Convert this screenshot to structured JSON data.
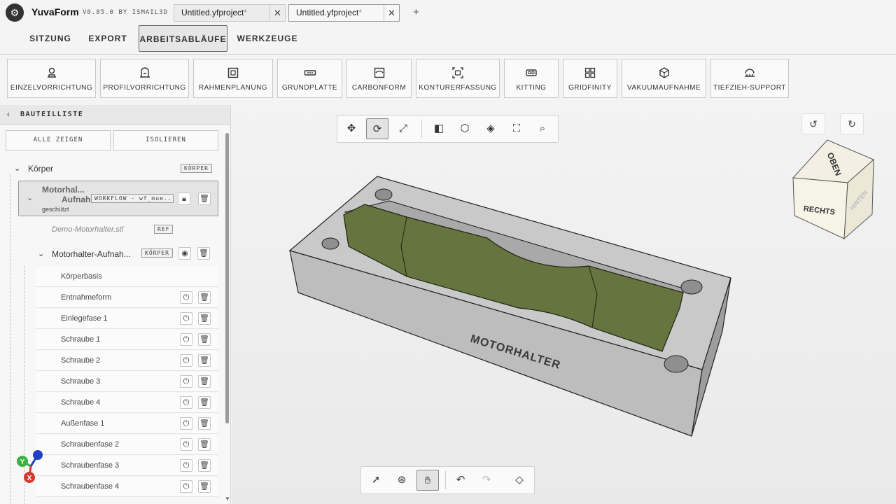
{
  "app": {
    "name": "YuvaForm",
    "version": "V0.85.0 BY ISMAIL3D"
  },
  "file_tabs": [
    {
      "label": "Untitled.yfproject",
      "modified_mark": "*"
    },
    {
      "label": "Untitled.yfproject",
      "modified_mark": "*"
    }
  ],
  "new_tab_label": "+",
  "menu": [
    "SITZUNG",
    "EXPORT",
    "ARBEITSABLÄUFE",
    "WERKZEUGE"
  ],
  "menu_active": "ARBEITSABLÄUFE",
  "workflows": [
    {
      "label": "EINZELVORRICHTUNG",
      "icon": "fixture-icon"
    },
    {
      "label": "PROFILVORRICHTUNG",
      "icon": "profile-fixture-icon"
    },
    {
      "label": "RAHMENPLANUNG",
      "icon": "frame-icon"
    },
    {
      "label": "GRUNDPLATTE",
      "icon": "baseplate-icon"
    },
    {
      "label": "CARBONFORM",
      "icon": "carbon-form-icon"
    },
    {
      "label": "KONTURERFASSUNG",
      "icon": "contour-icon"
    },
    {
      "label": "KITTING",
      "icon": "kitting-icon"
    },
    {
      "label": "GRIDFINITY",
      "icon": "grid-icon"
    },
    {
      "label": "VAKUUMAUFNAHME",
      "icon": "vacuum-icon"
    },
    {
      "label": "TIEFZIEH-SUPPORT",
      "icon": "thermoform-icon"
    }
  ],
  "panel": {
    "title": "BAUTEILLISTE",
    "show_all": "ALLE ZEIGEN",
    "isolate": "ISOLIEREN",
    "root": {
      "label": "Körper",
      "badge": "KÖRPER"
    },
    "group": {
      "label_line1": "Motorhal...",
      "label_line2": "Aufnahme",
      "sub": "geschützt",
      "badge": "WORKFLOW · wf_mue..."
    },
    "ref_file": {
      "label": "Demo-Motorhalter.stl",
      "badge": "REF"
    },
    "body": {
      "label": "Motorhalter-Aufnah...",
      "badge": "KÖRPER"
    },
    "base_feature": "Körperbasis",
    "features": [
      "Entnahmeform",
      "Einlegefase 1",
      "Schraube 1",
      "Schraube 2",
      "Schraube 3",
      "Schraube 4",
      "Außenfase 1",
      "Schraubenfase 2",
      "Schraubenfase 3",
      "Schraubenfase 4"
    ]
  },
  "model": {
    "engraving": "MOTORHALTER",
    "body_color": "#cdcdcd",
    "part_color": "#66743f"
  },
  "viewcube": {
    "top": "OBEN",
    "front": "RECHTS",
    "side": "HINTEN"
  },
  "axes": {
    "y": "Y",
    "x": "X"
  },
  "colors": {
    "accent": "#333333",
    "axis_y": "#3cb043",
    "axis_x": "#d23b2f",
    "axis_z": "#1f3fc9"
  }
}
